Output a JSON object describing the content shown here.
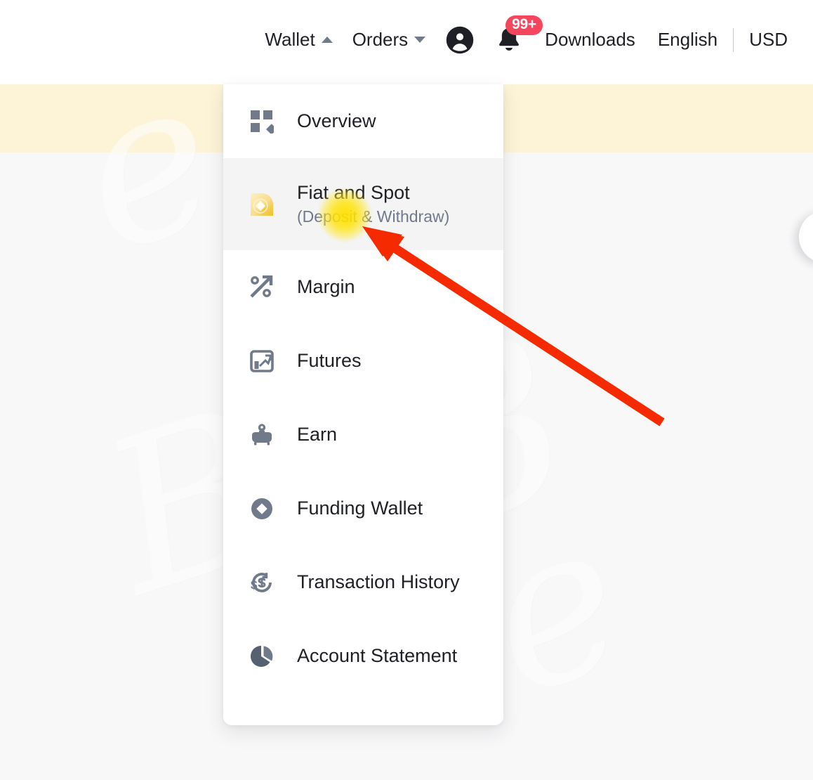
{
  "header": {
    "nav_items": [
      {
        "label": "Wallet",
        "icon": "caret-up-icon",
        "state": "expanded"
      },
      {
        "label": "Orders",
        "icon": "caret-down-icon",
        "state": "collapsed"
      }
    ],
    "account_icon": "user-circle-icon",
    "notifications": {
      "icon": "bell-icon",
      "badge_count": "99+",
      "badge_color": "#f6465d"
    },
    "downloads_label": "Downloads",
    "language_label": "English",
    "currency_label": "USD",
    "divider": "|"
  },
  "wallet_menu": {
    "items": [
      {
        "label": "Overview",
        "sub": "",
        "icon": "grid-squares-icon",
        "hovered": false
      },
      {
        "label": "Fiat and Spot",
        "sub": "(Deposit & Withdraw)",
        "icon": "fiat-spot-coin-icon",
        "hovered": true
      },
      {
        "label": "Margin",
        "sub": "",
        "icon": "margin-percent-arrow-icon",
        "hovered": false
      },
      {
        "label": "Futures",
        "sub": "",
        "icon": "futures-chart-icon",
        "hovered": false
      },
      {
        "label": "Earn",
        "sub": "",
        "icon": "piggy-bank-icon",
        "hovered": false
      },
      {
        "label": "Funding Wallet",
        "sub": "",
        "icon": "funding-diamond-icon",
        "hovered": false
      },
      {
        "label": "Transaction History",
        "sub": "",
        "icon": "dollar-clock-icon",
        "hovered": false
      },
      {
        "label": "Account Statement",
        "sub": "",
        "icon": "pie-chart-icon",
        "hovered": false
      }
    ]
  },
  "annotation": {
    "arrow_color": "#f62a00",
    "highlight_color": "#ffe000",
    "target_label": "Fiat and Spot (Deposit & Withdraw)"
  },
  "theme": {
    "banner_color": "#fdf3d7",
    "page_bg": "#f8f8f9",
    "panel_bg": "#ffffff",
    "hover_bg": "#f4f4f5",
    "text_primary": "#1e2026",
    "text_secondary": "#707a8a",
    "icon_gray": "#707a8a",
    "icon_gold": "#f0b90b"
  },
  "watermark": {
    "glyphs": [
      "e",
      "B",
      "e",
      "B",
      "e"
    ]
  },
  "float_button": {
    "name": "support-bubble-button"
  }
}
